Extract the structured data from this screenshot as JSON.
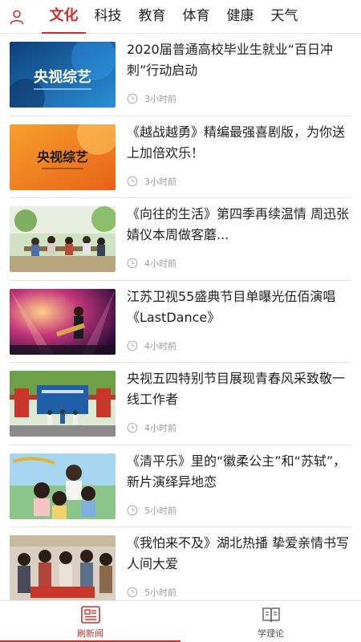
{
  "header": {
    "user_icon": "user-icon",
    "tabs": [
      {
        "label": "文化",
        "active": true
      },
      {
        "label": "科技",
        "active": false
      },
      {
        "label": "教育",
        "active": false
      },
      {
        "label": "体育",
        "active": false
      },
      {
        "label": "健康",
        "active": false
      },
      {
        "label": "天气",
        "active": false
      }
    ]
  },
  "colors": {
    "accent": "#d12b2b",
    "meta": "#9a9a9a"
  },
  "news": [
    {
      "title": "2020届普通高校毕业生就业“百日冲刺”行动启动",
      "time": "3小时前",
      "thumb_text": "央视综艺",
      "clock_icon": "clock-icon"
    },
    {
      "title": "《越战越勇》精编最强喜剧版，为你送上加倍欢乐！",
      "time": "3小时前",
      "thumb_text": "央视综艺",
      "clock_icon": "clock-icon"
    },
    {
      "title": "《向往的生活》第四季再续温情  周迅张婧仪本周做客蘑...",
      "time": "4小时前",
      "clock_icon": "clock-icon"
    },
    {
      "title": "江苏卫视55盛典节目单曝光伍佰演唱《LastDance》",
      "time": "4小时前",
      "clock_icon": "clock-icon"
    },
    {
      "title": "央视五四特别节目展现青春风采致敬一线工作者",
      "time": "4小时前",
      "clock_icon": "clock-icon"
    },
    {
      "title": "《清平乐》里的“徽柔公主”和“苏轼”，新片演绎异地恋",
      "time": "5小时前",
      "clock_icon": "clock-icon"
    },
    {
      "title": "《我怕来不及》湖北热播 挚爱亲情书写人间大爱",
      "time": "5小时前",
      "clock_icon": "clock-icon"
    }
  ],
  "bottom_nav": [
    {
      "label": "刷新闻",
      "icon": "news-icon",
      "active": true
    },
    {
      "label": "学理论",
      "icon": "book-icon",
      "active": false
    }
  ]
}
